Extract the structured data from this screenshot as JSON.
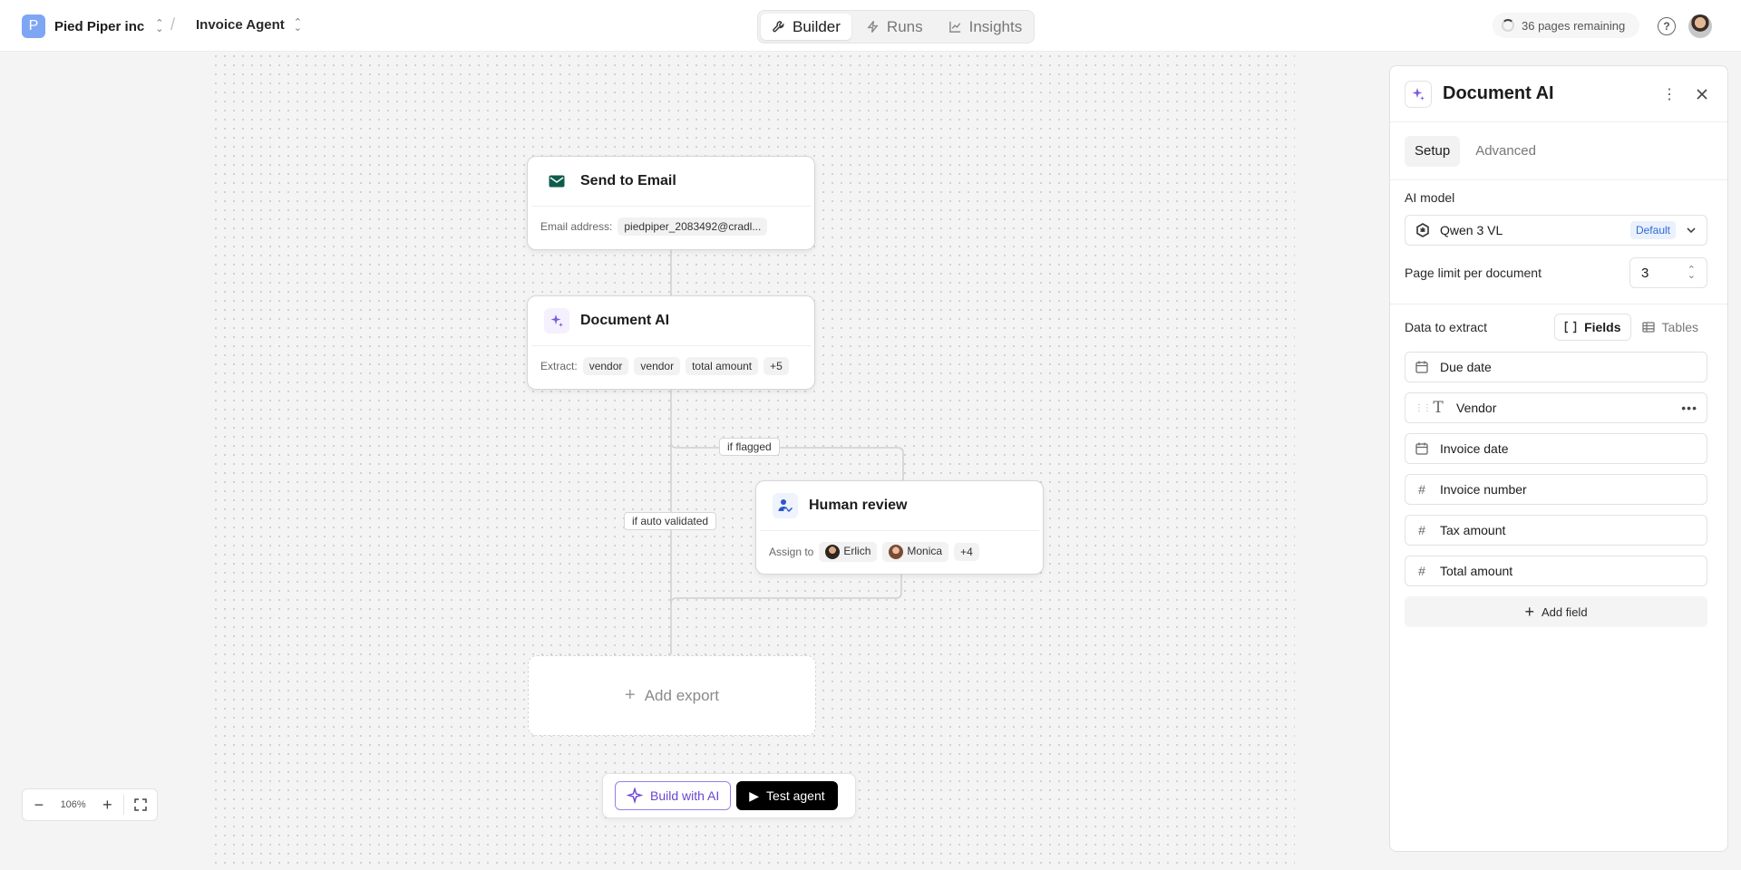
{
  "workspace": {
    "initial": "P",
    "name": "Pied Piper inc"
  },
  "breadcrumb_separator": "/",
  "agent": {
    "name": "Invoice Agent"
  },
  "nav_tabs": [
    {
      "label": "Builder",
      "icon": "wrench-icon",
      "active": true
    },
    {
      "label": "Runs",
      "icon": "bolt-icon",
      "active": false
    },
    {
      "label": "Insights",
      "icon": "chart-line-icon",
      "active": false
    }
  ],
  "pages_remaining": "36 pages remaining",
  "help_glyph": "?",
  "nodes": {
    "email": {
      "title": "Send to Email",
      "icon": "envelope-icon",
      "field_label": "Email address:",
      "field_value": "piedpiper_2083492@cradl..."
    },
    "document_ai": {
      "title": "Document AI",
      "icon": "sparkle-icon",
      "field_label": "Extract:",
      "chips": [
        "vendor",
        "vendor",
        "total amount"
      ],
      "more": "+5"
    },
    "human_review": {
      "title": "Human review",
      "icon": "user-check-icon",
      "field_label": "Assign to",
      "assignees": [
        "Erlich",
        "Monica"
      ],
      "more": "+4"
    },
    "add_export": {
      "label": "Add export"
    }
  },
  "edge_labels": {
    "flagged": "if flagged",
    "auto_validated": "if auto validated"
  },
  "zoom": {
    "level": "106%"
  },
  "actions": {
    "build_ai": "Build with AI",
    "test_agent": "Test agent"
  },
  "panel": {
    "title": "Document AI",
    "tabs": [
      {
        "label": "Setup",
        "active": true
      },
      {
        "label": "Advanced",
        "active": false
      }
    ],
    "ai_model_label": "AI model",
    "ai_model_value": "Qwen 3 VL",
    "ai_model_badge": "Default",
    "page_limit_label": "Page limit per document",
    "page_limit_value": "3",
    "extract_label": "Data to extract",
    "extract_modes": [
      {
        "label": "Fields",
        "active": true
      },
      {
        "label": "Tables",
        "active": false
      }
    ],
    "fields": [
      {
        "label": "Due date",
        "type_icon": "calendar-icon"
      },
      {
        "label": "Vendor",
        "type_icon": "text-type-icon"
      },
      {
        "label": "Invoice date",
        "type_icon": "calendar-icon"
      },
      {
        "label": "Invoice number",
        "type_icon": "hash-icon"
      },
      {
        "label": "Tax amount",
        "type_icon": "hash-icon"
      },
      {
        "label": "Total amount",
        "type_icon": "hash-icon"
      }
    ],
    "add_field_label": "Add field"
  },
  "colors": {
    "accent_purple": "#6a45d0",
    "workspace_badge": "#7fa6f5",
    "email_icon": "#0f5c4c",
    "review_icon": "#2d56c9",
    "default_badge": "#2e6bd6"
  }
}
